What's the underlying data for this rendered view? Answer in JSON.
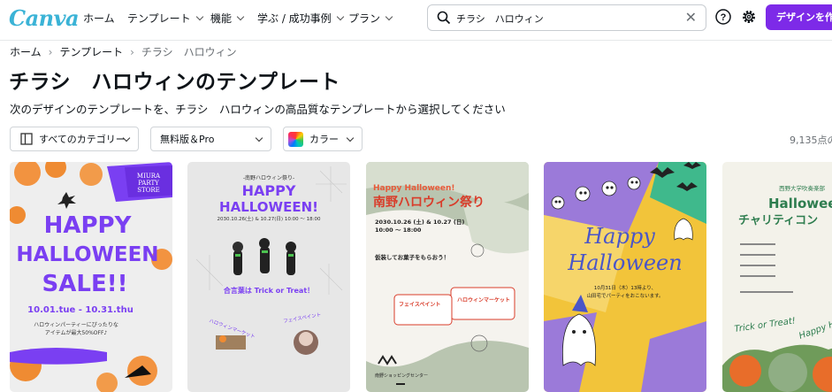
{
  "app": {
    "logo": "Canva"
  },
  "nav": {
    "home": "ホーム",
    "templates": "テンプレート",
    "features": "機能",
    "learn": "学ぶ / 成功事例",
    "plans": "プラン"
  },
  "search": {
    "value": "チラシ　ハロウィン"
  },
  "header_cta": "デザインを作成",
  "breadcrumb": {
    "home": "ホーム",
    "templates": "テンプレート",
    "current": "チラシ　ハロウィン"
  },
  "page": {
    "title": "チラシ　ハロウィンのテンプレート",
    "subtitle": "次のデザインのテンプレートを、チラシ　ハロウィンの高品質なテンプレートから選択してください"
  },
  "filters": {
    "category": "すべてのカテゴリー",
    "price": "無料版＆Pro",
    "color": "カラー",
    "result_count": "9,135点の"
  },
  "cards": [
    {
      "store": [
        "MIURA",
        "PARTY",
        "STORE"
      ],
      "line1": "HAPPY",
      "line2": "HALLOWEEN",
      "line3": "SALE!!",
      "dates": "10.01.tue - 10.31.thu",
      "note1": "ハロウィンパーティーにぴったりな",
      "note2": "アイテムが最大50%OFF♪"
    },
    {
      "eyebrow": "-南野ハロウィン祭り-",
      "line1": "HAPPY",
      "line2": "HALLOWEEN!",
      "date": "2030.10.26(土) & 10.27(日) 10:00 〜 18:00",
      "banner": "合言葉は Trick or Treat！",
      "left_title": "ハロウィンマーケット",
      "right_title": "フェイスペイント"
    },
    {
      "eyebrow": "Happy Halloween!",
      "title": "南野ハロウィン祭り",
      "date": "2030.10.26 (土) & 10.27 (日)",
      "time": "10:00 〜 18:00",
      "section": "仮装してお菓子をもらおう！",
      "box1": "フェイスペイント",
      "box2": "ハロウィンマーケット",
      "footer": "南野ショッピングセンター"
    },
    {
      "script1": "Happy",
      "script2": "Halloween",
      "date": "10月31日（木）13時より、",
      "note": "山田宅でパーティをおこないます。"
    },
    {
      "eyebrow": "西野大学吹奏楽部",
      "line1": "Halloween",
      "line2": "チャリティコン",
      "trick": "Trick or Treat!",
      "happy": "Happy H"
    }
  ]
}
